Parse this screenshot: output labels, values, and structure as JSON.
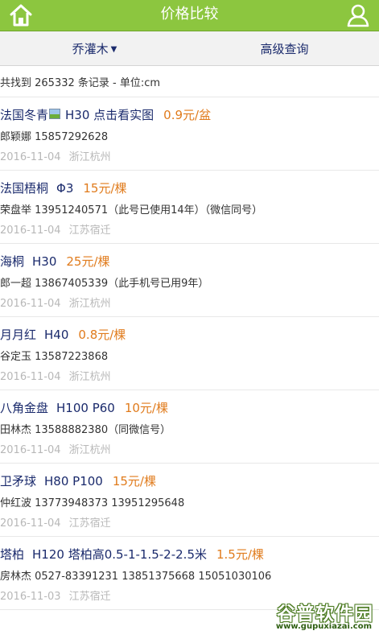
{
  "header": {
    "title": "价格比较",
    "home_icon": "home-icon",
    "user_icon": "user-icon",
    "bar_color": "#8cc63f"
  },
  "filters": {
    "category_label": "乔灌木",
    "advanced_label": "高级查询"
  },
  "summary": "共找到 265332 条记录 - 单位:cm",
  "accent_color": "#e07b1c",
  "items": [
    {
      "title": "法国冬青",
      "has_image_icon": true,
      "spec": "H30  点击看实图",
      "price": "0.9元/盆",
      "contact": "郎颖娜  15857292628",
      "date": "2016-11-04",
      "location": "浙江杭州"
    },
    {
      "title": "法国梧桐",
      "spec": "Φ3",
      "price": "15元/棵",
      "contact": "荣盘举  13951240571（此号已使用14年）（微信同号）",
      "date": "2016-11-04",
      "location": "江苏宿迁"
    },
    {
      "title": "海桐",
      "spec": "H30",
      "price": "25元/棵",
      "contact": "郎一超  13867405339（此手机号已用9年）",
      "date": "2016-11-04",
      "location": "浙江杭州"
    },
    {
      "title": "月月红",
      "spec": "H40",
      "price": "0.8元/棵",
      "contact": "谷定玉  13587223868",
      "date": "2016-11-04",
      "location": "浙江杭州"
    },
    {
      "title": "八角金盘",
      "spec": "H100 P60",
      "price": "10元/棵",
      "contact": "田林杰  13588882380（同微信号）",
      "date": "2016-11-04",
      "location": "浙江杭州"
    },
    {
      "title": "卫矛球",
      "spec": "H80 P100",
      "price": "15元/棵",
      "contact": "仲红波  13773948373 13951295648",
      "date": "2016-11-04",
      "location": "江苏宿迁"
    },
    {
      "title": "塔柏",
      "spec": "H120  塔柏高0.5-1-1.5-2-2.5米",
      "price": "1.5元/棵",
      "contact": "房林杰  0527-83391231 13851375668 15051030106",
      "date": "2016-11-03",
      "location": "江苏宿迁"
    }
  ],
  "watermark": {
    "name": "谷普软件园",
    "url": "www.gupuxiazai.com"
  }
}
